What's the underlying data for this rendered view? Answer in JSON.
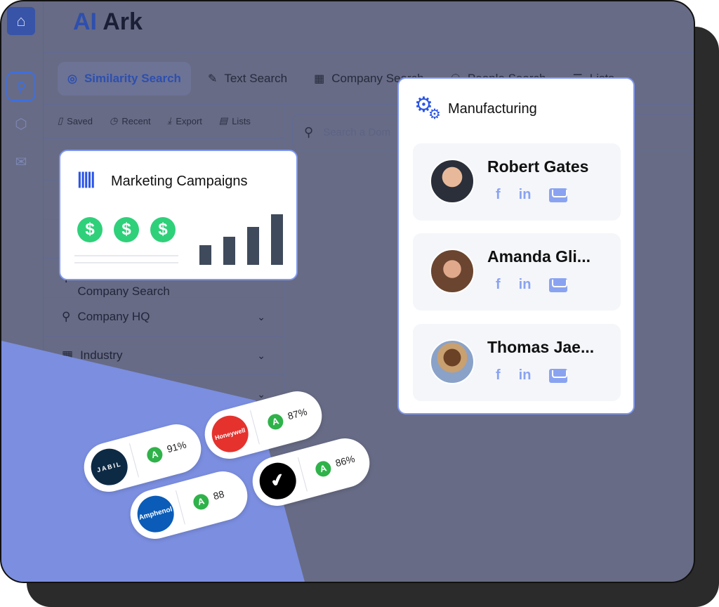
{
  "app": {
    "brand_a": "AI",
    "brand_b": "Ark"
  },
  "tabs": [
    {
      "label": "Similarity Search",
      "icon": "fingerprint-icon",
      "active": true
    },
    {
      "label": "Text Search",
      "icon": "feather-icon"
    },
    {
      "label": "Company Search",
      "icon": "building-icon"
    },
    {
      "label": "People Search",
      "icon": "people-icon"
    },
    {
      "label": "Lists",
      "icon": "list-icon"
    }
  ],
  "tools": [
    {
      "label": "Saved",
      "icon": "bookmark-icon"
    },
    {
      "label": "Recent",
      "icon": "clock-icon"
    },
    {
      "label": "Export",
      "icon": "download-icon"
    },
    {
      "label": "Lists",
      "icon": "list-icon"
    }
  ],
  "search": {
    "placeholder": "Search a Dom"
  },
  "filters": [
    {
      "label": "Company Search"
    },
    {
      "label": "Company HQ",
      "icon": "location-pin-icon"
    },
    {
      "label": "Industry",
      "icon": "building-icon"
    }
  ],
  "marketing": {
    "title": "Marketing Campaigns",
    "bars": [
      28,
      40,
      54,
      72
    ]
  },
  "manufacturing": {
    "title": "Manufacturing",
    "people": [
      {
        "name": "Robert Gates"
      },
      {
        "name": "Amanda Gli..."
      },
      {
        "name": "Thomas Jae..."
      }
    ]
  },
  "companies": [
    {
      "name": "JABIL",
      "grade": "A",
      "score": "91%",
      "color": "#0d2a45"
    },
    {
      "name": "Honeywell",
      "grade": "A",
      "score": "87%",
      "color": "#e5322d"
    },
    {
      "name": "Amphenol",
      "grade": "A",
      "score": "88",
      "color": "#0a5cb8"
    },
    {
      "name": "",
      "grade": "A",
      "score": "86%",
      "color": "#000000"
    }
  ],
  "colors": {
    "accent": "#2b55e6",
    "grade": "#2fb24a",
    "overlay": "#676b85",
    "highlight": "#7b8ee0"
  }
}
